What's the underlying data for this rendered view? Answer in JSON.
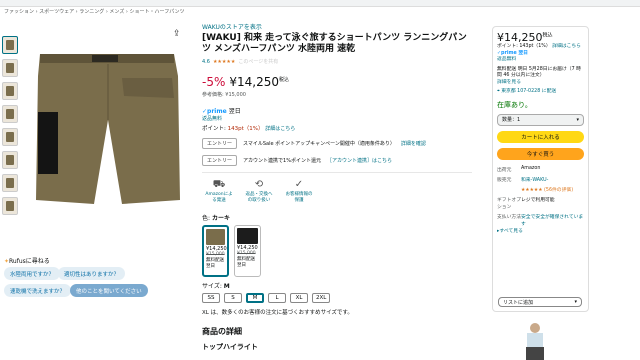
{
  "breadcrumb": "ファッション › スポーツウェア › ランニング › メンズ › ショート・ハーフパンツ",
  "product": {
    "store": "WAKUのストアを表示",
    "title": "[WAKU] 和来 走って泳ぐ旅するショートパンツ ランニングパンツ メンズハーフパンツ 水陸両用 速乾",
    "rating": "4.6",
    "stars": "★★★★★",
    "ratings_link": "このページを共有",
    "discount": "-5%",
    "price": "¥14,250",
    "price_suffix": "税込",
    "reference": "参考価格: ¥15,000",
    "prime_label": "✓prime",
    "prime_day": "翌日",
    "returns": "返品無料",
    "points_label": "ポイント:",
    "points_value": "143pt（1%）",
    "points_link": "詳細はこちら"
  },
  "promotions": [
    {
      "tag": "エントリー",
      "text": "スマイルSale ポイントアップキャンペーン開催中（適用条件あり）",
      "link": "詳細を確認"
    },
    {
      "tag": "エントリー",
      "text": "アカウント連携で1%ポイント還元",
      "link": "［アカウント連携］はこちら"
    }
  ],
  "feature_icons": [
    {
      "icon": "truck-icon",
      "glyph": "⛟",
      "label": "Amazonによる発送"
    },
    {
      "icon": "return-icon",
      "glyph": "⟲",
      "label": "返品・交換への取り扱い"
    },
    {
      "icon": "secure-icon",
      "glyph": "✓",
      "label": "お客様情報の保護"
    }
  ],
  "color": {
    "label": "色:",
    "value": "カーキ",
    "options": [
      {
        "price": "¥14,250",
        "strike": "¥15,000",
        "note": "無料配送 翌日",
        "color": "#7a6d4b",
        "selected": true
      },
      {
        "price": "¥14,250",
        "strike": "¥15,000",
        "note": "無料配送 翌日",
        "color": "#1c1c1c",
        "selected": false
      }
    ]
  },
  "size": {
    "label": "サイズ:",
    "value": "M",
    "options": [
      "SS",
      "S",
      "M",
      "L",
      "XL",
      "2XL"
    ],
    "note": "XL は、数多くのお客様の注文に基づくおすすめサイズです。"
  },
  "sections": {
    "details": "商品の詳細",
    "highlights": "トップハイライト"
  },
  "rufus": {
    "label": "Rufusに尋ねる",
    "chips": [
      "水陸両用ですか？",
      "適切性はありますか？",
      "速乾機で洗えますか？",
      "他のことを聞いてください"
    ]
  },
  "buybox": {
    "price": "¥14,250",
    "price_suffix": "税込",
    "points": "ポイント: 143pt（1%）",
    "points_link": "詳細はこちら",
    "prime": "✓prime 翌日",
    "returns": "返品無料",
    "delivery": "無料配送 明日 5月28日にお届け（7 時間 46 分以内に注文）",
    "delivery_link": "詳細を見る",
    "address": "東京都 107-0228 に配送",
    "stock": "在庫あり。",
    "quantity": "数量：1",
    "cart_button": "カートに入れる",
    "buy_button": "今すぐ買う",
    "table": [
      {
        "k": "出荷元",
        "v": "Amazon"
      },
      {
        "k": "販売元",
        "v": "和来-WAKU-"
      },
      {
        "k": "",
        "v": "★★★★★ (56件の評価)"
      },
      {
        "k": "ギフトオプション",
        "v": "レジで利用可能"
      },
      {
        "k": "支払い方法",
        "v": "安全で安全が確保されています"
      }
    ],
    "more": "▸すべて見る",
    "wishlist": "リストに追加"
  }
}
